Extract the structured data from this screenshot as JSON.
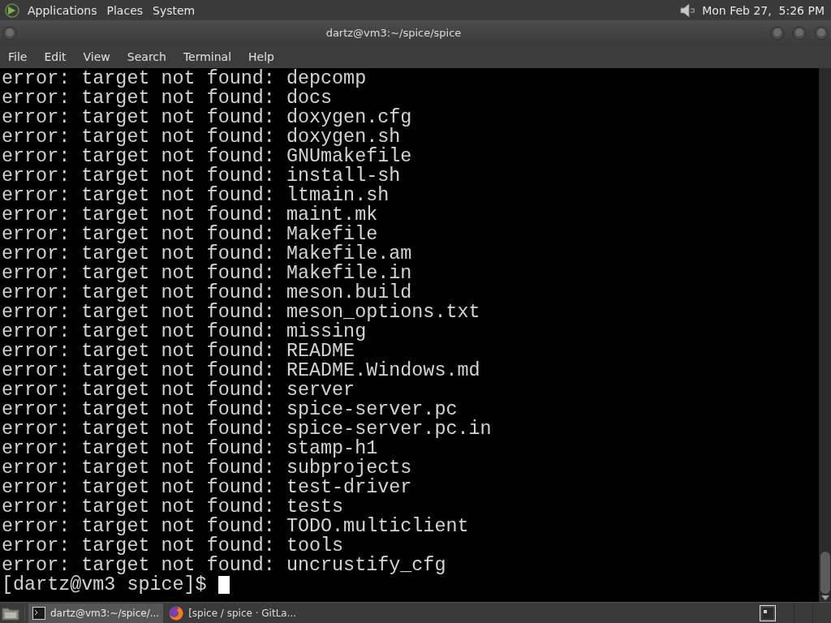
{
  "top_panel": {
    "menus": [
      "Applications",
      "Places",
      "System"
    ],
    "clock": "Mon Feb 27,  5:26 PM"
  },
  "window": {
    "title": "dartz@vm3:~/spice/spice"
  },
  "menu_bar": [
    "File",
    "Edit",
    "View",
    "Search",
    "Terminal",
    "Help"
  ],
  "terminal": {
    "lines": [
      "error: target not found: depcomp",
      "error: target not found: docs",
      "error: target not found: doxygen.cfg",
      "error: target not found: doxygen.sh",
      "error: target not found: GNUmakefile",
      "error: target not found: install-sh",
      "error: target not found: ltmain.sh",
      "error: target not found: maint.mk",
      "error: target not found: Makefile",
      "error: target not found: Makefile.am",
      "error: target not found: Makefile.in",
      "error: target not found: meson.build",
      "error: target not found: meson_options.txt",
      "error: target not found: missing",
      "error: target not found: README",
      "error: target not found: README.Windows.md",
      "error: target not found: server",
      "error: target not found: spice-server.pc",
      "error: target not found: spice-server.pc.in",
      "error: target not found: stamp-h1",
      "error: target not found: subprojects",
      "error: target not found: test-driver",
      "error: target not found: tests",
      "error: target not found: TODO.multiclient",
      "error: target not found: tools",
      "error: target not found: uncrustify_cfg"
    ],
    "prompt": "[dartz@vm3 spice]$ "
  },
  "taskbar": {
    "tasks": [
      {
        "kind": "terminal",
        "label": "dartz@vm3:~/spice/...",
        "selected": true
      },
      {
        "kind": "browser",
        "label": "[spice / spice · GitLa...",
        "selected": false
      }
    ]
  }
}
